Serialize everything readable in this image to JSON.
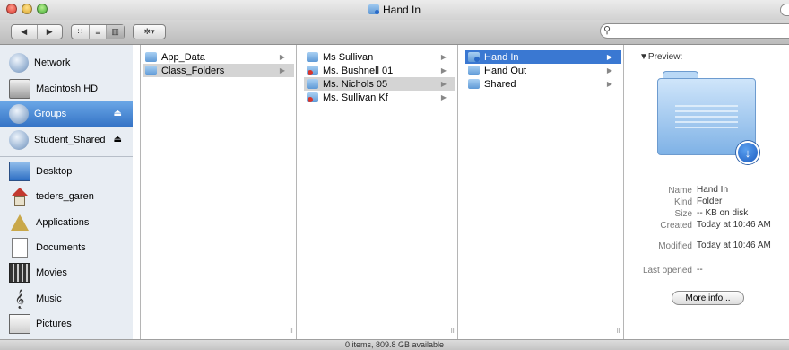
{
  "window": {
    "title": "Hand In"
  },
  "toolbar": {
    "back_label": "◀",
    "forward_label": "▶",
    "view_icon_label": "∷",
    "view_list_label": "≡",
    "view_column_label": "▥",
    "action_label": "✲▾",
    "search_placeholder": ""
  },
  "sidebar": {
    "devices": [
      {
        "label": "Network",
        "icon": "globe-icon"
      },
      {
        "label": "Macintosh HD",
        "icon": "hard-drive-icon"
      },
      {
        "label": "Groups",
        "icon": "globe-icon",
        "eject": "⏏",
        "selected": true
      },
      {
        "label": "Student_Shared",
        "icon": "globe-icon",
        "eject": "⏏"
      }
    ],
    "places": [
      {
        "label": "Desktop",
        "icon": "desktop-icon"
      },
      {
        "label": "teders_garen",
        "icon": "home-icon"
      },
      {
        "label": "Applications",
        "icon": "applications-icon"
      },
      {
        "label": "Documents",
        "icon": "documents-icon"
      },
      {
        "label": "Movies",
        "icon": "movies-icon"
      },
      {
        "label": "Music",
        "icon": "music-icon"
      },
      {
        "label": "Pictures",
        "icon": "pictures-icon"
      }
    ]
  },
  "columns": {
    "col1": [
      {
        "label": "App_Data",
        "arrow": "▶"
      },
      {
        "label": "Class_Folders",
        "arrow": "▶",
        "state": "gray"
      }
    ],
    "col2": [
      {
        "label": "Ms Sullivan",
        "arrow": "▶"
      },
      {
        "label": "Ms. Bushnell 01",
        "arrow": "▶"
      },
      {
        "label": "Ms. Nichols 05",
        "arrow": "▶",
        "state": "gray"
      },
      {
        "label": "Ms. Sullivan Kf",
        "arrow": "▶"
      }
    ],
    "col3": [
      {
        "label": "Hand In",
        "arrow": "▶",
        "state": "blue"
      },
      {
        "label": "Hand Out",
        "arrow": "▶"
      },
      {
        "label": "Shared",
        "arrow": "▶"
      }
    ]
  },
  "preview": {
    "heading": "▼Preview:",
    "download_badge": "↓",
    "fields": [
      {
        "key": "Name",
        "value": "Hand In"
      },
      {
        "key": "Kind",
        "value": "Folder"
      },
      {
        "key": "Size",
        "value": "-- KB on disk"
      },
      {
        "key": "Created",
        "value": "Today at 10:46 AM"
      },
      {
        "key": "Modified",
        "value": "Today at 10:46 AM"
      },
      {
        "key": "Last opened",
        "value": "--"
      }
    ],
    "more_info_label": "More info..."
  },
  "status": {
    "text": "0 items, 809.8 GB available"
  },
  "col_resize_glyph": "॥"
}
